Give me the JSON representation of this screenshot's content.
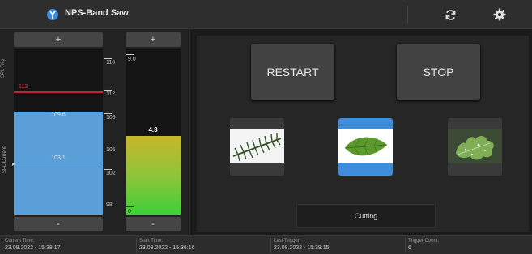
{
  "app": {
    "title": "NPS-Band Saw"
  },
  "spl_meter": {
    "plus_label": "+",
    "minus_label": "-",
    "side_label_trig": "SPL Trig",
    "side_label_spl": "SPL Current",
    "scale_min": 96.5,
    "scale_max": 117.5,
    "ticks": [
      "116",
      "112",
      "109",
      "105",
      "102",
      "98"
    ],
    "peak": 109.6,
    "peak_label": "109.6",
    "current": 103.1,
    "current_label": "103.1",
    "trigger": 112,
    "trigger_label": "112",
    "fill_color": "#5b9fd8",
    "trigger_color": "#c0262a"
  },
  "trigger_meter": {
    "plus_label": "+",
    "minus_label": "-",
    "top_label": "9.0",
    "bottom_label": "0",
    "max": 9.0,
    "value": 4.3,
    "value_label": "4.3"
  },
  "controls": {
    "restart_label": "RESTART",
    "stop_label": "STOP"
  },
  "modes": [
    {
      "name": "conifer",
      "icon": "conifer-branch-icon",
      "selected": false
    },
    {
      "name": "leaf",
      "icon": "deciduous-leaf-icon",
      "selected": true
    },
    {
      "name": "oak",
      "icon": "oak-leaf-icon",
      "selected": false
    }
  ],
  "status": {
    "text": "Cutting"
  },
  "footer": {
    "current_time_label": "Current Time:",
    "current_time_value": "23.08.2022 - 15:38:17",
    "start_time_label": "Start Time:",
    "start_time_value": "23.08.2022 - 15:36:16",
    "last_trigger_label": "Last Trigger:",
    "last_trigger_value": "23.08.2022 - 15:38:15",
    "trigger_count_label": "Trigger Count:",
    "trigger_count_value": "6"
  },
  "colors": {
    "background": "#1a1a1a",
    "accent_selected": "#3f8cd8",
    "meter_gradient_top": "#c9b62a",
    "meter_gradient_bottom": "#3dcf3a"
  }
}
